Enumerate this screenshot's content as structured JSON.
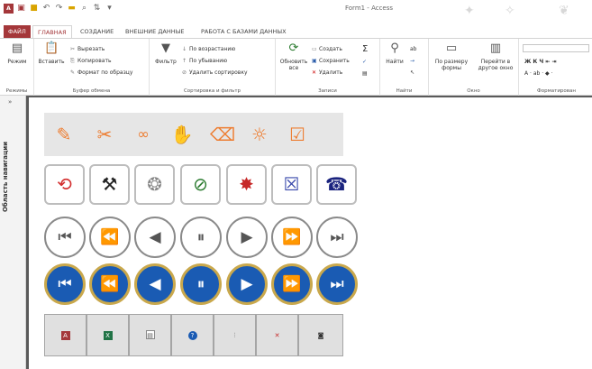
{
  "window": {
    "title": "Form1 - Access"
  },
  "tabs": [
    "ФАЙЛ",
    "ГЛАВНАЯ",
    "СОЗДАНИЕ",
    "ВНЕШНИЕ ДАННЫЕ",
    "РАБОТА С БАЗАМИ ДАННЫХ"
  ],
  "ribbon": {
    "modes": {
      "label": "Режим",
      "group": "Режимы"
    },
    "clipboard": {
      "paste": "Вставить",
      "cut": "Вырезать",
      "copy": "Копировать",
      "format": "Формат по образцу",
      "group": "Буфер обмена"
    },
    "sort": {
      "filter": "Фильтр",
      "asc": "По возрастанию",
      "desc": "По убыванию",
      "remove": "Удалить сортировку",
      "group": "Сортировка и фильтр"
    },
    "records": {
      "refresh": "Обновить",
      "refresh2": "все",
      "create": "Создать",
      "save": "Сохранить",
      "delete": "Удалить",
      "group": "Записи"
    },
    "find": {
      "find": "Найти",
      "group": "Найти"
    },
    "window": {
      "fit": "По размеру",
      "fit2": "формы",
      "goto": "Перейти в",
      "goto2": "другое окно",
      "group": "Окно"
    },
    "formatting": {
      "group": "Форматирован"
    }
  },
  "nav": {
    "label": "Область навигации"
  },
  "icons": {
    "orange_row": [
      "pencil-icon",
      "scissors-icon",
      "glasses-icon",
      "hand-icon",
      "backspace-icon",
      "sun-icon",
      "checkbox-icon"
    ],
    "square_row": [
      "undo-timer-icon",
      "tools-icon",
      "web-icon",
      "no-smoking-icon",
      "explode-icon",
      "close-box-icon",
      "telephone-icon"
    ],
    "gray_nav": [
      "first-icon",
      "rewind-icon",
      "prev-icon",
      "pause-icon",
      "next-icon",
      "fast-forward-icon",
      "last-icon"
    ],
    "blue_nav": [
      "first-icon",
      "rewind-icon",
      "prev-icon",
      "pause-icon",
      "next-icon",
      "fast-forward-icon",
      "last-icon"
    ],
    "bottom": [
      "access-icon",
      "excel-icon",
      "form-icon",
      "help-icon",
      "properties-icon",
      "clear-filter-icon",
      "camera-icon"
    ]
  },
  "colors": {
    "accent": "#a4373a",
    "orange": "#ed7d31",
    "blue": "#1a5bb3",
    "gold": "#c9a84c"
  }
}
